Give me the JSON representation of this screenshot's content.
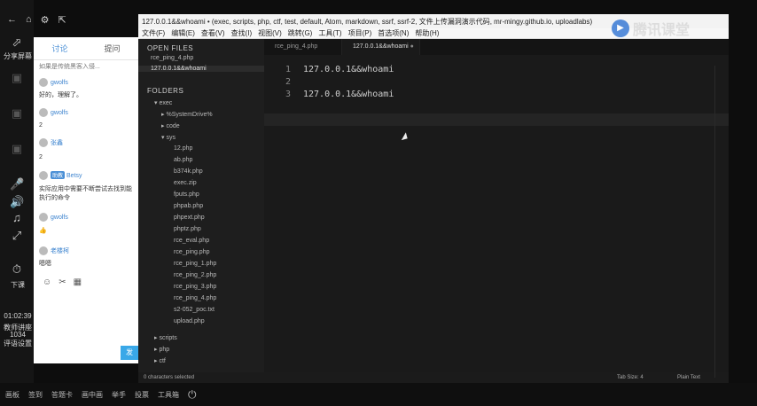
{
  "rail": {
    "share_label": "分享屏幕",
    "volume_label": "下课",
    "time": "01:02:39",
    "line2": "教师讲座",
    "line3": "1034",
    "line4": "评语设置"
  },
  "chat": {
    "tab_discussion": "讨论",
    "tab_other": "提问",
    "msgs": [
      {
        "text": "如果是传统黑客入侵..."
      },
      {
        "name": "gwolfs",
        "text": "好的，理解了。"
      },
      {
        "name": "gwolfs",
        "text": "2"
      },
      {
        "name": "张鑫",
        "text": "2"
      },
      {
        "badge": "助教",
        "name": "Betsy",
        "text": "实际应用中需要不断尝试去找到能执行的命令"
      },
      {
        "name": "gwolfs",
        "text": "👍"
      },
      {
        "name": "老楼柯",
        "text": "嗯嗯"
      }
    ],
    "send_label": "发"
  },
  "atom": {
    "title": "127.0.0.1&&whoami • (exec, scripts, php, ctf, test, default, Atom, markdown, ssrf, ssrf-2, 文件上传漏洞演示代码, mr-mingy.github.io, uploadlabs)",
    "menu": [
      "文件(F)",
      "编辑(E)",
      "查看(V)",
      "查找(I)",
      "视图(V)",
      "跳转(G)",
      "工具(T)",
      "项目(P)",
      "首选项(N)",
      "帮助(H)"
    ],
    "open_files_header": "OPEN FILES",
    "open_files": [
      "rce_ping_4.php",
      "127.0.0.1&&whoami"
    ],
    "folders_header": "FOLDERS",
    "tree": [
      "exec",
      "%SystemDrive%",
      "code",
      "sys",
      "12.php",
      "ab.php",
      "b374k.php",
      "exec.zip",
      "fputs.php",
      "phpab.php",
      "phpext.php",
      "phptz.php",
      "rce_eval.php",
      "rce_ping.php",
      "rce_ping_1.php",
      "rce_ping_2.php",
      "rce_ping_3.php",
      "rce_ping_4.php",
      "s2-052_poc.txt",
      "upload.php",
      "scripts",
      "php",
      "ctf"
    ],
    "tabs": [
      "rce_ping_4.php",
      "127.0.0.1&&whoami"
    ],
    "lines": [
      "127.0.0.1&&whoami",
      "",
      "127.0.0.1&&whoami"
    ],
    "line_numbers": [
      "1",
      "2",
      "3"
    ],
    "status_left": "0 characters selected",
    "status_tab": "Tab Size: 4",
    "status_syntax": "Plain Text"
  },
  "logo": {
    "text": "腾讯课堂"
  },
  "bottombar": [
    "画板",
    "签到",
    "答题卡",
    "画中画",
    "举手",
    "投票",
    "工具箱"
  ]
}
